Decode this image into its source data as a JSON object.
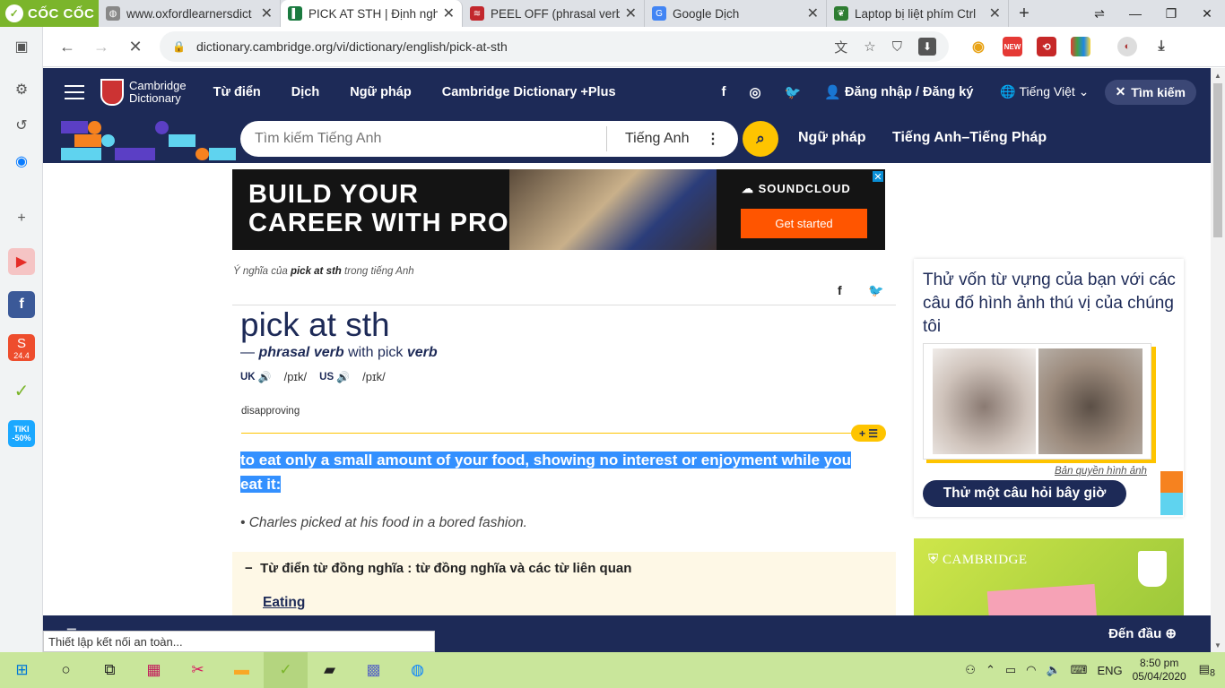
{
  "browser": {
    "brand": "CỐC CỐC",
    "tabs": [
      {
        "title": "www.oxfordlearnersdict",
        "active": false
      },
      {
        "title": "PICK AT STH | Định nghĩ",
        "active": true
      },
      {
        "title": "PEEL OFF (phrasal verb)",
        "active": false
      },
      {
        "title": "Google Dịch",
        "active": false
      },
      {
        "title": "Laptop bị liệt phím Ctrl",
        "active": false
      }
    ],
    "url": "dictionary.cambridge.org/vi/dictionary/english/pick-at-sth",
    "ext_new_label": "NEW",
    "status_text": "Thiết lập kết nối an toàn...",
    "sidebar_badges": {
      "shopee": "24.4",
      "tiki_top": "TIKI",
      "tiki_bottom": "-50%"
    }
  },
  "site": {
    "logo_line1": "Cambridge",
    "logo_line2": "Dictionary",
    "nav": [
      "Từ điển",
      "Dịch",
      "Ngữ pháp",
      "Cambridge Dictionary +Plus"
    ],
    "login": "Đăng nhập / Đăng ký",
    "language": "Tiếng Việt",
    "search_pill": "Tìm kiếm",
    "search_placeholder": "Tìm kiếm Tiếng Anh",
    "search_lang": "Tiếng Anh",
    "sub_links": [
      "Ngữ pháp",
      "Tiếng Anh–Tiếng Pháp"
    ]
  },
  "ad": {
    "line1": "BUILD YOUR",
    "line2": "CAREER WITH PRO",
    "brand": "SOUNDCLOUD",
    "cta": "Get started"
  },
  "entry": {
    "crumb_prefix": "Ý nghĩa của",
    "crumb_word": "pick at sth",
    "crumb_suffix": "trong tiếng Anh",
    "headword": "pick at sth",
    "pos_prefix": "—",
    "pos_main": "phrasal verb",
    "pos_with": "with pick",
    "pos_verb": "verb",
    "uk_label": "UK",
    "us_label": "US",
    "uk_ipa": "/pɪk/",
    "us_ipa": "/pɪk/",
    "usage_label": "disapproving",
    "definition": "to eat only a small amount of your food, showing no interest or enjoyment while you eat it:",
    "example": "Charles picked at his food in a bored fashion.",
    "thesaurus_title": "Từ điển từ đồng nghĩa : từ đồng nghĩa và các từ liên quan",
    "thesaurus_word": "Eating"
  },
  "quiz": {
    "question": "Thử vốn từ vựng của bạn với các câu đố hình ảnh thú vị của chúng tôi",
    "credit": "Bản quyền hình ảnh",
    "button": "Thử một câu hỏi bây giờ"
  },
  "cam_ad": {
    "name": "CAMBRIDGE"
  },
  "bottom": {
    "back_to_top": "Đến đầu"
  },
  "taskbar": {
    "lang": "ENG",
    "time": "8:50 pm",
    "date": "05/04/2020",
    "notif_count": "8"
  }
}
